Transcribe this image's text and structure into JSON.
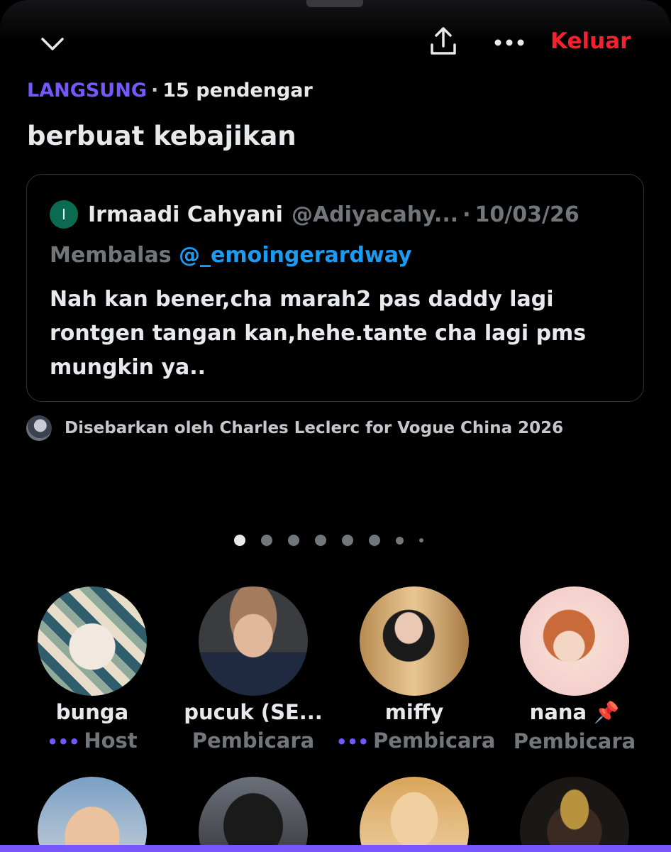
{
  "header": {
    "leave_label": "Keluar",
    "icons": [
      "chevron-down-icon",
      "share-icon",
      "more-icon"
    ]
  },
  "space": {
    "live_label": "LANGSUNG",
    "separator": "·",
    "listeners": "15 pendengar",
    "title": "berbuat kebajikan"
  },
  "pinned_post": {
    "avatar_initial": "I",
    "author": "Irmaadi Cahyani",
    "handle": "@Adiyacahy...",
    "separator": "·",
    "date": "10/03/26",
    "reply_prefix": "Membalas",
    "reply_to": "@_emoingerardway",
    "body": "Nah kan bener,cha marah2 pas daddy lagi rontgen tangan kan,hehe.tante cha lagi pms mungkin ya.."
  },
  "shared_by": {
    "text": "Disebarkan oleh Charles Leclerc for Vogue China 2026"
  },
  "pagination": {
    "current": 1,
    "total": 8
  },
  "participants": [
    {
      "name": "bunga",
      "role": "Host",
      "talking": true,
      "talk_glyph": "•••"
    },
    {
      "name": "pucuk (SE...",
      "role": "Pembicara",
      "talking": false,
      "talk_glyph": ""
    },
    {
      "name": "miffy",
      "role": "Pembicara",
      "talking": true,
      "talk_glyph": "•••"
    },
    {
      "name": "nana 📌",
      "role": "Pembicara",
      "talking": false,
      "talk_glyph": ""
    }
  ],
  "colors": {
    "accent": "#7856ff",
    "leave": "#f4212e",
    "mention": "#1d9bf0",
    "muted": "#71767b"
  }
}
